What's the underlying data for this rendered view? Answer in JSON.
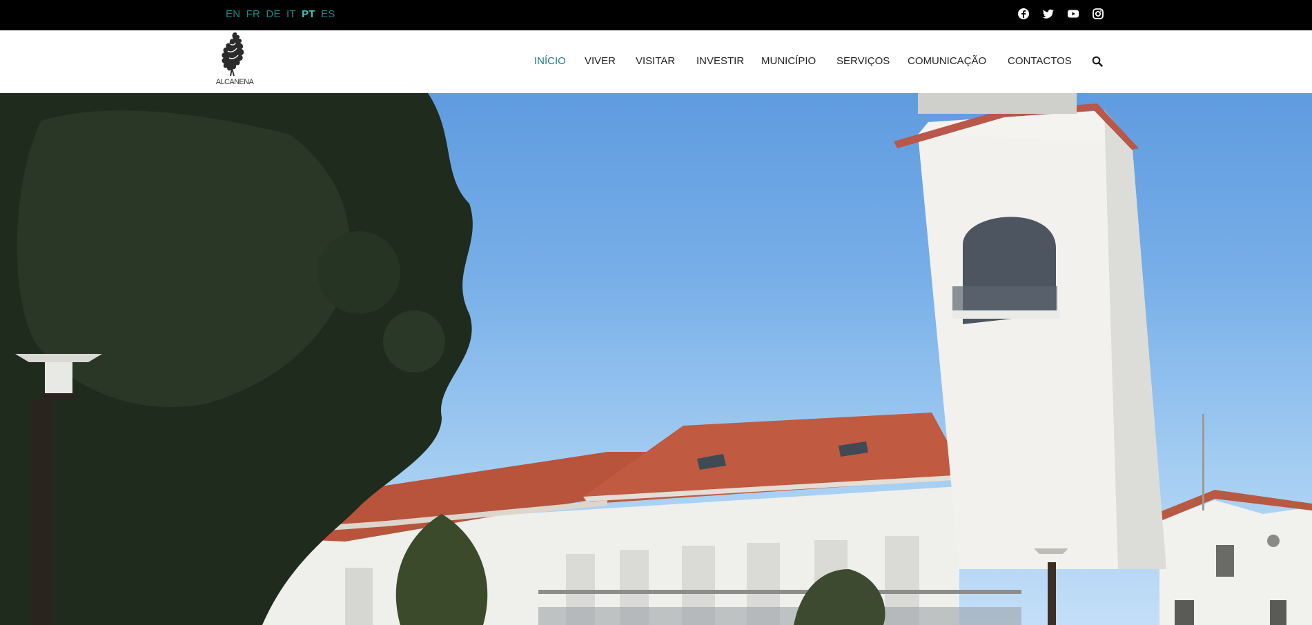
{
  "languages": [
    {
      "code": "EN",
      "active": false
    },
    {
      "code": "FR",
      "active": false
    },
    {
      "code": "DE",
      "active": false
    },
    {
      "code": "IT",
      "active": false
    },
    {
      "code": "PT",
      "active": true
    },
    {
      "code": "ES",
      "active": false
    }
  ],
  "social": [
    "facebook-icon",
    "twitter-icon",
    "youtube-icon",
    "instagram-icon"
  ],
  "logo": {
    "text": "ALCANENA"
  },
  "nav": {
    "items": [
      {
        "label": "INÍCIO",
        "active": true
      },
      {
        "label": "VIVER"
      },
      {
        "label": "VISITAR"
      },
      {
        "label": "INVESTIR"
      },
      {
        "label": "MUNICÍPIO"
      },
      {
        "label": "SERVIÇOS"
      },
      {
        "label": "COMUNICAÇÃO"
      },
      {
        "label": "CONTACTOS"
      }
    ],
    "search_icon": "search-icon"
  },
  "colors": {
    "topbar": "#000000",
    "lang_link": "#1f8a8a",
    "lang_active": "#3fc4c4",
    "nav_active": "#1e7d7d",
    "nav_text": "#222222"
  }
}
